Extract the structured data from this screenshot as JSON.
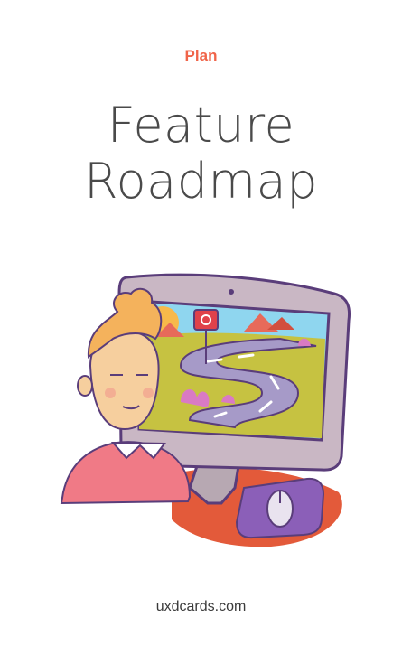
{
  "card": {
    "category": "Plan",
    "title_line1": "Feature",
    "title_line2": "Roadmap",
    "footer": "uxdcards.com"
  },
  "illustration": {
    "name": "person-with-monitor-roadmap-illustration"
  },
  "colors": {
    "accent": "#f06449",
    "title": "#4a4a4a",
    "footer": "#3a3a3a"
  }
}
